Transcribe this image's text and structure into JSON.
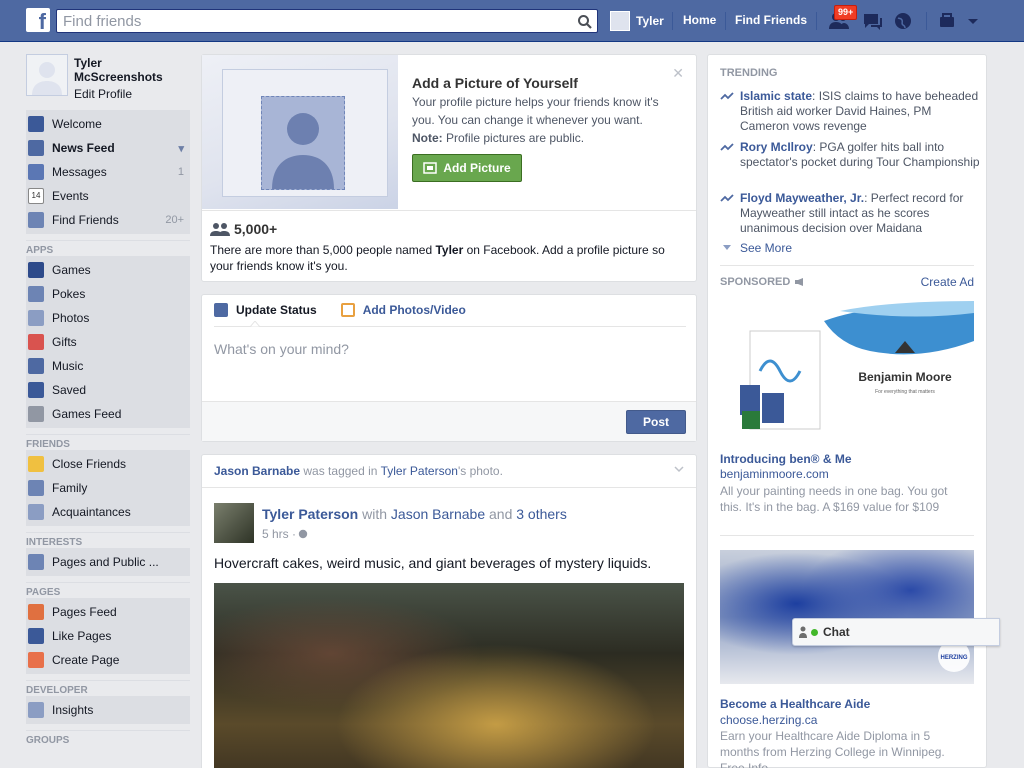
{
  "topbar": {
    "logo": "f",
    "search_placeholder": "Find friends",
    "user_name": "Tyler",
    "home": "Home",
    "find_friends": "Find Friends",
    "notif_badge": "99+"
  },
  "profile": {
    "name": "Tyler McScreenshots",
    "edit": "Edit Profile"
  },
  "sidebar": {
    "main": [
      {
        "label": "Welcome",
        "count": ""
      },
      {
        "label": "News Feed",
        "count": ""
      },
      {
        "label": "Messages",
        "count": "1"
      },
      {
        "label": "Events",
        "count": ""
      },
      {
        "label": "Find Friends",
        "count": "20+"
      }
    ],
    "events_icon_num": "14",
    "apps_header": "APPS",
    "apps": [
      "Games",
      "Pokes",
      "Photos",
      "Gifts",
      "Music",
      "Saved",
      "Games Feed"
    ],
    "friends_header": "FRIENDS",
    "friends": [
      "Close Friends",
      "Family",
      "Acquaintances"
    ],
    "interests_header": "INTERESTS",
    "interests": [
      "Pages and Public ..."
    ],
    "pages_header": "PAGES",
    "pages": [
      "Pages Feed",
      "Like Pages",
      "Create Page"
    ],
    "developer_header": "DEVELOPER",
    "developer": [
      "Insights"
    ],
    "groups_header": "GROUPS"
  },
  "addpic": {
    "title": "Add a Picture of Yourself",
    "desc": "Your profile picture helps your friends know it's you. You can change it whenever you want.",
    "note_label": "Note:",
    "note_text": " Profile pictures are public.",
    "button": "Add Picture",
    "count": "5,000+",
    "count_desc_pre": "There are more than 5,000 people named ",
    "count_name": "Tyler",
    "count_desc_post": " on Facebook. Add a profile picture so your friends know it's you."
  },
  "composer": {
    "tab_status": "Update Status",
    "tab_photos": "Add Photos/Video",
    "placeholder": "What's on your mind?",
    "post": "Post"
  },
  "story": {
    "header_user": "Jason Barnabe",
    "header_mid": " was tagged in ",
    "header_owner": "Tyler Paterson",
    "header_end": "'s photo.",
    "author": "Tyler Paterson",
    "with": " with ",
    "tagged": "Jason Barnabe",
    "and": " and ",
    "others": "3 others",
    "time": "5 hrs · ",
    "text": "Hovercraft cakes, weird music, and giant beverages of mystery liquids."
  },
  "trending": {
    "header": "TRENDING",
    "items": [
      {
        "topic": "Islamic state",
        "text": ": ISIS claims to have beheaded British aid worker David Haines, PM Cameron vows revenge"
      },
      {
        "topic": "Rory McIlroy",
        "text": ": PGA golfer hits ball into spectator's pocket during Tour Championship"
      },
      {
        "topic": "Floyd Mayweather, Jr.",
        "text": ": Perfect record for Mayweather still intact as he scores unanimous decision over Maidana"
      }
    ],
    "see_more": "See More"
  },
  "sponsored": {
    "header": "SPONSORED",
    "create_ad": "Create Ad",
    "ad1": {
      "brand": "Benjamin Moore",
      "tagline": "For everything that matters",
      "title": "Introducing ben® & Me",
      "url": "benjaminmoore.com",
      "body": "All your painting needs in one bag. You got this. It's in the bag. A $169 value for $109"
    },
    "ad2": {
      "badge": "HERZING",
      "title": "Become a Healthcare Aide",
      "url": "choose.herzing.ca",
      "body": "Earn your Healthcare Aide Diploma in 5 months from Herzing College in Winnipeg. Free Info."
    }
  },
  "chat": {
    "label": "Chat"
  },
  "colors": {
    "brand": "#4e69a2",
    "link": "#3b5998",
    "green": "#69a74e",
    "badge": "#f03d25"
  }
}
